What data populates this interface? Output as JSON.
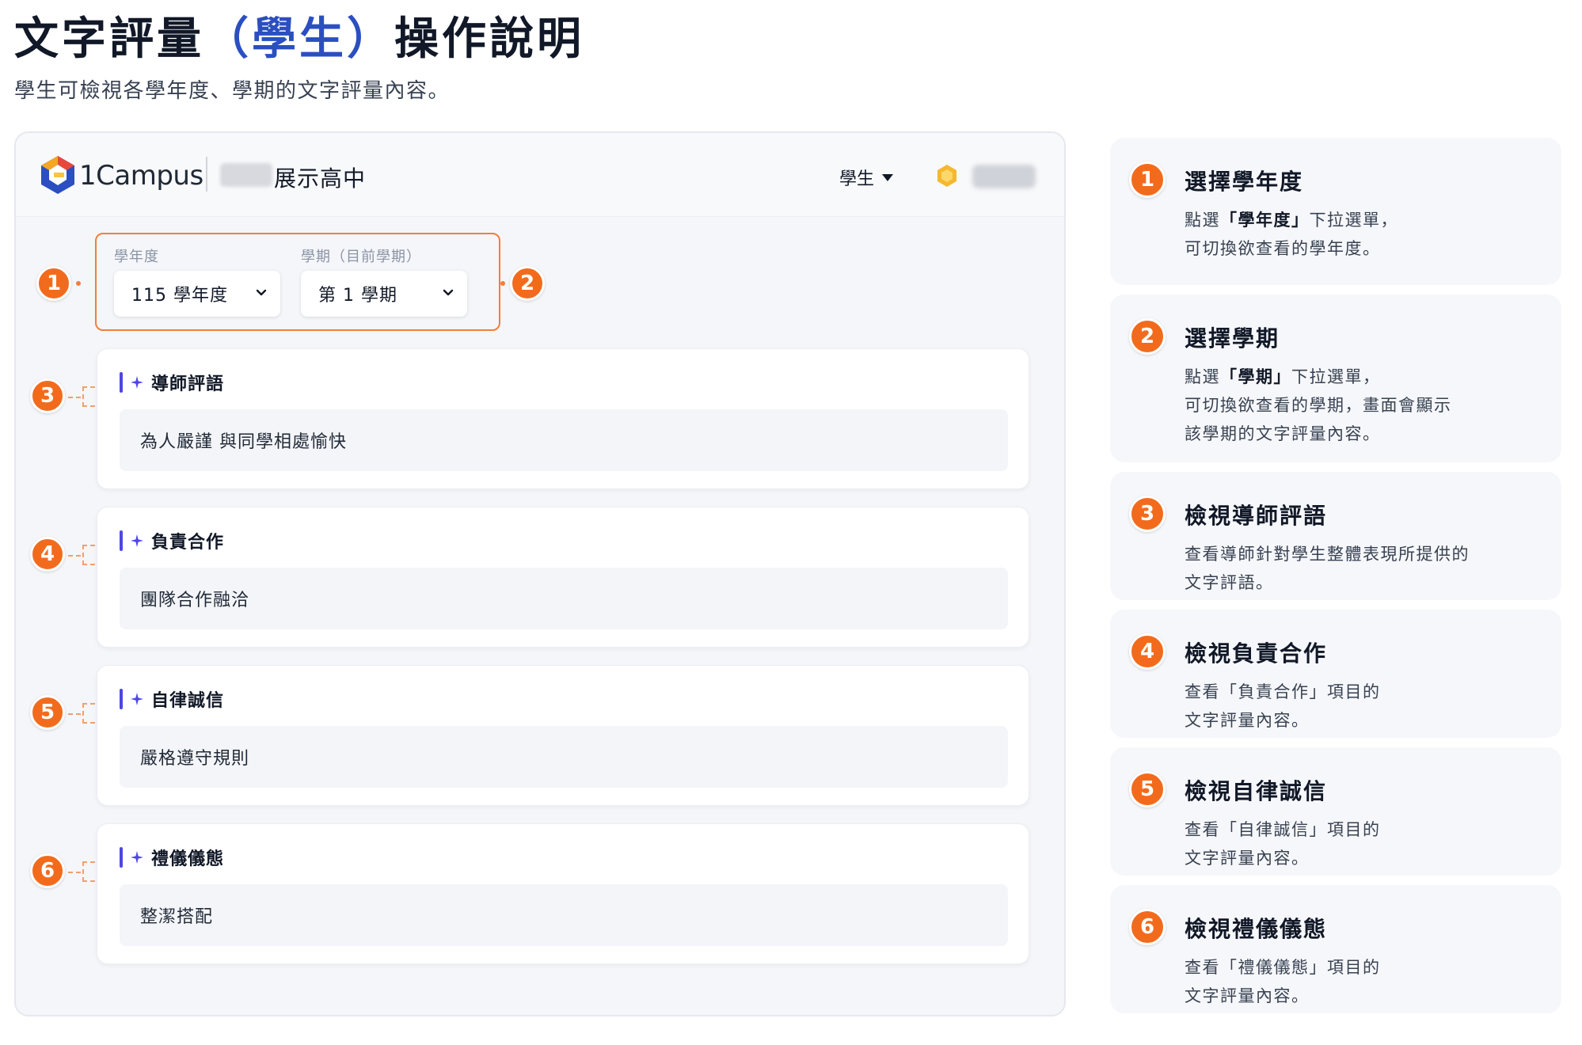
{
  "page": {
    "title_pre": "文字評量",
    "title_hl": "（學生）",
    "title_post": "操作說明",
    "subtitle": "學生可檢視各學年度、學期的文字評量內容。"
  },
  "app": {
    "logo_text": "1Campus",
    "school_name": "展示高中",
    "role": "學生",
    "year_label": "學年度",
    "year_value": "115 學年度",
    "semester_label": "學期（目前學期）",
    "semester_value": "第 1 學期",
    "cards": [
      {
        "number": "3",
        "title": "導師評語",
        "content": "為人嚴謹 與同學相處愉快"
      },
      {
        "number": "4",
        "title": "負責合作",
        "content": "團隊合作融洽"
      },
      {
        "number": "5",
        "title": "自律誠信",
        "content": "嚴格遵守規則"
      },
      {
        "number": "6",
        "title": "禮儀儀態",
        "content": "整潔搭配"
      }
    ]
  },
  "markers": {
    "year": "1",
    "semester": "2"
  },
  "steps": [
    {
      "number": "1",
      "title": "選擇學年度",
      "line1_pre": "點選",
      "line1_bold": "「學年度」",
      "line1_post": "下拉選單，",
      "line2": "可切換欲查看的學年度。"
    },
    {
      "number": "2",
      "title": "選擇學期",
      "line1_pre": "點選",
      "line1_bold": "「學期」",
      "line1_post": "下拉選單，",
      "line2": "可切換欲查看的學期，畫面會顯示",
      "line3": "該學期的文字評量內容。"
    },
    {
      "number": "3",
      "title": "檢視導師評語",
      "line1": "查看導師針對學生整體表現所提供的",
      "line2": "文字評語。"
    },
    {
      "number": "4",
      "title": "檢視負責合作",
      "line1": "查看「負責合作」項目的",
      "line2": "文字評量內容。"
    },
    {
      "number": "5",
      "title": "檢視自律誠信",
      "line1": "查看「自律誠信」項目的",
      "line2": "文字評量內容。"
    },
    {
      "number": "6",
      "title": "檢視禮儀儀態",
      "line1": "查看「禮儀儀態」項目的",
      "line2": "文字評量內容。"
    }
  ],
  "colors": {
    "accent": "#f26b1d",
    "title_highlight": "#2b4fc0",
    "card_bar": "#4f46e5"
  }
}
